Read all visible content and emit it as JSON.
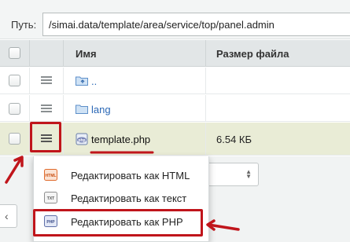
{
  "pathbar": {
    "label": "Путь:",
    "value": "/simai.data/template/area/service/top/panel.admin"
  },
  "table": {
    "columns": {
      "name": "Имя",
      "size": "Размер файла"
    },
    "rows": [
      {
        "name": "..",
        "size": "",
        "icon": "folder-up-icon"
      },
      {
        "name": "lang",
        "size": "",
        "icon": "folder-icon"
      },
      {
        "name": "template.php",
        "size": "6.54 КБ",
        "icon": "php-file-icon"
      }
    ]
  },
  "context_menu": {
    "items": [
      {
        "label": "Редактировать как HTML",
        "icon": "html-icon",
        "icon_text": "HTML"
      },
      {
        "label": "Редактировать как текст",
        "icon": "txt-icon",
        "icon_text": "TXT"
      },
      {
        "label": "Редактировать как PHP",
        "icon": "php-icon",
        "icon_text": "PHP"
      }
    ]
  },
  "colors": {
    "selected_row": "#e9ecd6",
    "link": "#2b68b6",
    "annotation_red": "#c0151b",
    "header_bg": "#e2e6e7"
  }
}
